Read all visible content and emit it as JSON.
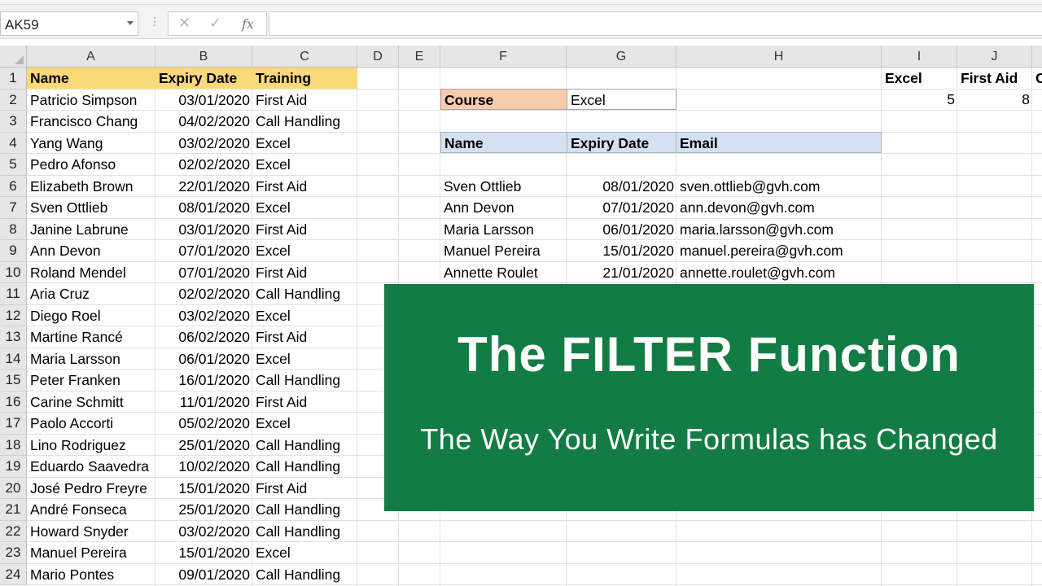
{
  "formula_bar": {
    "name_box": "AK59",
    "dots": "⋮",
    "cancel_icon": "✕",
    "enter_icon": "✓",
    "fx_icon": "fx",
    "formula": ""
  },
  "columns": [
    "A",
    "B",
    "C",
    "D",
    "E",
    "F",
    "G",
    "H",
    "I",
    "J"
  ],
  "headers": {
    "name": "Name",
    "expiry": "Expiry Date",
    "training": "Training"
  },
  "rows": [
    [
      "Patricio Simpson",
      "03/01/2020",
      "First Aid"
    ],
    [
      "Francisco Chang",
      "04/02/2020",
      "Call Handling"
    ],
    [
      "Yang Wang",
      "03/02/2020",
      "Excel"
    ],
    [
      "Pedro Afonso",
      "02/02/2020",
      "Excel"
    ],
    [
      "Elizabeth Brown",
      "22/01/2020",
      "First Aid"
    ],
    [
      "Sven Ottlieb",
      "08/01/2020",
      "Excel"
    ],
    [
      "Janine Labrune",
      "03/01/2020",
      "First Aid"
    ],
    [
      "Ann Devon",
      "07/01/2020",
      "Excel"
    ],
    [
      "Roland Mendel",
      "07/01/2020",
      "First Aid"
    ],
    [
      "Aria Cruz",
      "02/02/2020",
      "Call Handling"
    ],
    [
      "Diego Roel",
      "03/02/2020",
      "Excel"
    ],
    [
      "Martine Rancé",
      "06/02/2020",
      "First Aid"
    ],
    [
      "Maria Larsson",
      "06/01/2020",
      "Excel"
    ],
    [
      "Peter Franken",
      "16/01/2020",
      "Call Handling"
    ],
    [
      "Carine Schmitt",
      "11/01/2020",
      "First Aid"
    ],
    [
      "Paolo Accorti",
      "05/02/2020",
      "Excel"
    ],
    [
      "Lino Rodriguez",
      "25/01/2020",
      "Call Handling"
    ],
    [
      "Eduardo Saavedra",
      "10/02/2020",
      "Call Handling"
    ],
    [
      "José Pedro Freyre",
      "15/01/2020",
      "First Aid"
    ],
    [
      "André Fonseca",
      "25/01/2020",
      "Call Handling"
    ],
    [
      "Howard Snyder",
      "03/02/2020",
      "Call Handling"
    ],
    [
      "Manuel Pereira",
      "15/01/2020",
      "Excel"
    ],
    [
      "Mario Pontes",
      "09/01/2020",
      "Call Handling"
    ]
  ],
  "row_numbers": [
    "1",
    "2",
    "3",
    "4",
    "5",
    "6",
    "7",
    "8",
    "9",
    "10",
    "11",
    "12",
    "13",
    "14",
    "15",
    "16",
    "17",
    "18",
    "19",
    "20",
    "21",
    "22",
    "23",
    "24"
  ],
  "course": {
    "label": "Course",
    "value": "Excel"
  },
  "results_headers": {
    "name": "Name",
    "expiry": "Expiry Date",
    "email": "Email"
  },
  "results": [
    [
      "Sven Ottlieb",
      "08/01/2020",
      "sven.ottlieb@gvh.com"
    ],
    [
      "Ann Devon",
      "07/01/2020",
      "ann.devon@gvh.com"
    ],
    [
      "Maria Larsson",
      "06/01/2020",
      "maria.larsson@gvh.com"
    ],
    [
      "Manuel Pereira",
      "15/01/2020",
      "manuel.pereira@gvh.com"
    ],
    [
      "Annette Roulet",
      "21/01/2020",
      "annette.roulet@gvh.com"
    ]
  ],
  "counts": {
    "excel_label": "Excel",
    "excel_value": "5",
    "firstaid_label": "First Aid",
    "firstaid_value": "8",
    "next_label_partial": "C"
  },
  "banner": {
    "title": "The FILTER Function",
    "subtitle": "The Way You Write Formulas has Changed"
  },
  "colors": {
    "banner_green": "#137c44",
    "header_yellow": "#fcd97a",
    "header_blue": "#d7dff2",
    "course_orange": "#f8cbad"
  }
}
